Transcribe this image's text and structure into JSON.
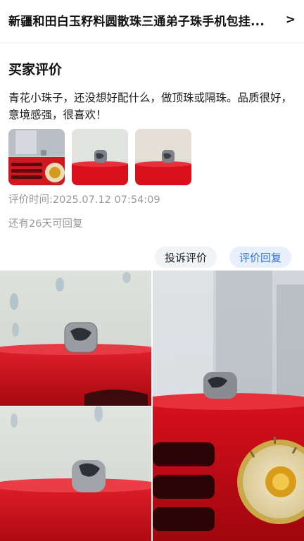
{
  "header": {
    "title": "新疆和田白玉籽料圆散珠三通弟子珠手机包挂...",
    "chevron": "chevron-right-icon"
  },
  "section": {
    "title": "买家评价"
  },
  "review": {
    "text": "青花小珠子，还没想好配什么，做顶珠或隔珠。品质很好，意境感强，很喜欢！",
    "time": "评价时间:2025.07.12 07:54:09",
    "reply_remaining": "还有26天可回复"
  },
  "actions": {
    "complain_label": "投诉评价",
    "reply_label": "评价回复"
  },
  "colors": {
    "accent": "#2f6fe0",
    "accent_bg": "#e8f0fd",
    "muted_text": "#999999",
    "radio_red": "#d0101c"
  }
}
